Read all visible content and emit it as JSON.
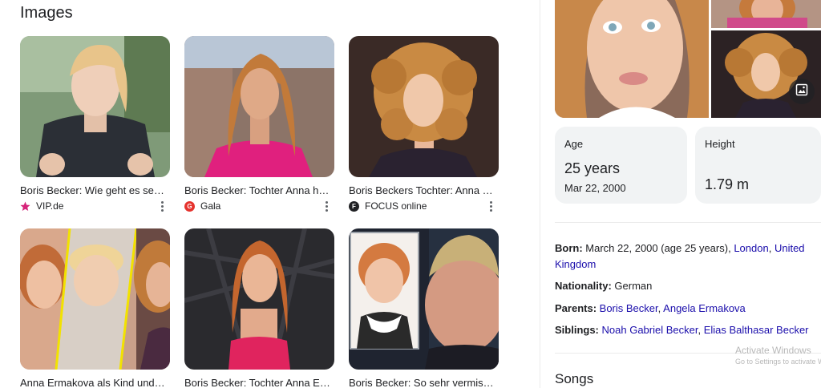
{
  "images_section": {
    "title": "Images",
    "cards": [
      {
        "caption": "Boris Becker: Wie geht es sei…",
        "source": "VIP.de",
        "favicon_icon": "pink-star-icon",
        "favicon_color": "#d6247a"
      },
      {
        "caption": "Boris Becker: Tochter Anna h…",
        "source": "Gala",
        "favicon_icon": "gala-logo-icon",
        "favicon_color": "#e5322d"
      },
      {
        "caption": "Boris Beckers Tochter: Anna …",
        "source": "FOCUS online",
        "favicon_icon": "focus-logo-icon",
        "favicon_color": "#202124"
      },
      {
        "caption": "Anna Ermakova als Kind und …",
        "source": "",
        "favicon_icon": "",
        "favicon_color": ""
      },
      {
        "caption": "Boris Becker: Tochter Anna E…",
        "source": "",
        "favicon_icon": "",
        "favicon_color": ""
      },
      {
        "caption": "Boris Becker: So sehr vermis…",
        "source": "",
        "favicon_icon": "",
        "favicon_color": ""
      }
    ]
  },
  "knowledge_panel": {
    "age": {
      "label": "Age",
      "value": "25 years",
      "sub": "Mar 22, 2000"
    },
    "height": {
      "label": "Height",
      "value": "1.79 m"
    },
    "born": {
      "label": "Born:",
      "text": "March 22, 2000 (age 25 years),",
      "link1": "London",
      "sep": ",",
      "link2": "United Kingdom"
    },
    "nationality": {
      "label": "Nationality:",
      "value": "German"
    },
    "parents": {
      "label": "Parents:",
      "link1": "Boris Becker",
      "sep": ",",
      "link2": "Angela Ermakova"
    },
    "siblings": {
      "label": "Siblings:",
      "link1": "Noah Gabriel Becker",
      "sep": ",",
      "link2": "Elias Balthasar Becker"
    },
    "songs_title": "Songs"
  },
  "watermark": {
    "line1": "Activate Windows",
    "line2": "Go to Settings to activate Windows."
  },
  "colors": {
    "link": "#1a0dab",
    "card_bg": "#f1f3f4"
  }
}
